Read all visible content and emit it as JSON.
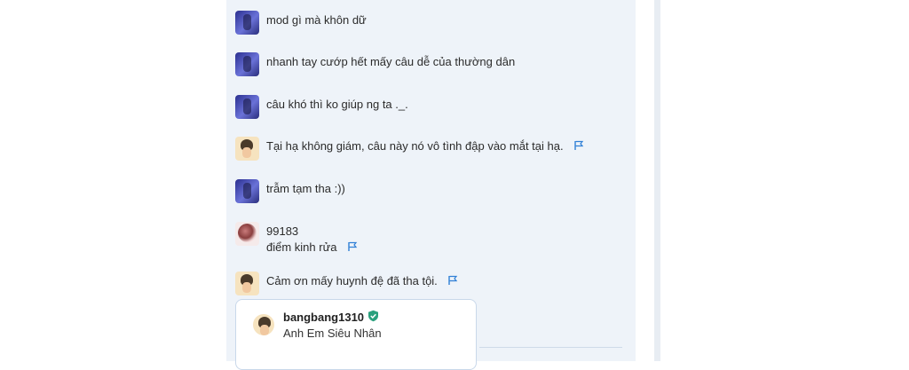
{
  "comments": [
    {
      "avatar": "purple-figure-avatar",
      "lines": [
        "mod gì mà khôn dữ"
      ],
      "flag": false
    },
    {
      "avatar": "purple-figure-avatar",
      "lines": [
        "nhanh tay cướp hết mấy câu dễ của thường dân"
      ],
      "flag": false
    },
    {
      "avatar": "purple-figure-avatar",
      "lines": [
        "câu khó thì ko giúp ng ta ._."
      ],
      "flag": false
    },
    {
      "avatar": "anime-boy-avatar",
      "lines": [
        "Tại hạ không giám, câu này nó vô tình đập vào mắt tại hạ."
      ],
      "flag": true
    },
    {
      "avatar": "purple-figure-avatar",
      "lines": [
        "trẫm tạm tha :))"
      ],
      "flag": false
    },
    {
      "avatar": "anime-girl-avatar",
      "lines": [
        "99183",
        "điểm kinh rửa"
      ],
      "flag": true
    },
    {
      "avatar": "anime-boy-avatar",
      "lines": [
        "Cảm ơn mấy huynh đệ đã tha tội."
      ],
      "flag": true
    }
  ],
  "user_card": {
    "username": "bangbang1310",
    "rank": "Anh Em Siêu Nhân",
    "badge_icon": "shield-check-icon"
  },
  "colors": {
    "panel_bg": "#eef3f9",
    "flag": "#2f7fd6",
    "verified": "#2aa07d"
  }
}
